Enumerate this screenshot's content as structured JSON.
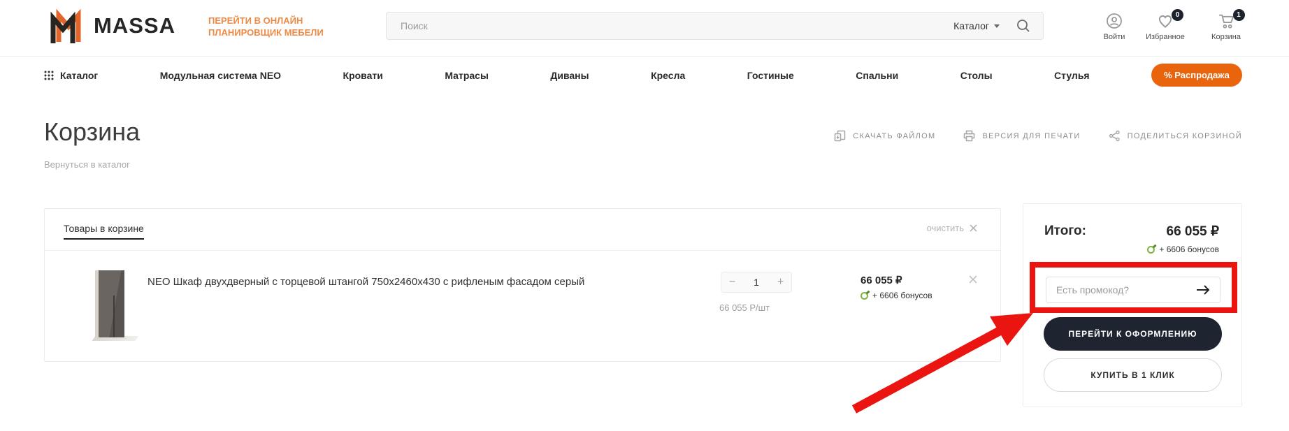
{
  "brand": {
    "name": "MASSA",
    "planner_link": "Перейти в онлайн планировщик мебели"
  },
  "header": {
    "search_placeholder": "Поиск",
    "catalog_dropdown": "Каталог",
    "account": {
      "label": "Войти"
    },
    "favorites": {
      "label": "Избранное",
      "count": "0"
    },
    "cart": {
      "label": "Корзина",
      "count": "1"
    }
  },
  "nav": {
    "items": [
      "Каталог",
      "Модульная система NEO",
      "Кровати",
      "Матрасы",
      "Диваны",
      "Кресла",
      "Гостиные",
      "Спальни",
      "Столы",
      "Стулья"
    ],
    "sale_label": "% Распродажа"
  },
  "page": {
    "title": "Корзина",
    "back_link": "Вернуться в каталог",
    "actions": [
      "Скачать файлом",
      "Версия для печати",
      "Поделиться корзиной"
    ]
  },
  "cart_panel": {
    "tab": "Товары в корзине",
    "clear_label": "очистить",
    "item": {
      "name": "NEO Шкаф двухдверный с торцевой штангой 750х2460х430 с рифленым фасадом серый",
      "quantity": "1",
      "qty_minus": "−",
      "qty_plus": "+",
      "price": "66 055 ₽",
      "bonus": "+ 6606 бонусов",
      "unit_price": "66 055 Р/шт"
    }
  },
  "summary": {
    "total_label": "Итого:",
    "total_value": "66 055 ₽",
    "bonus": "+ 6606 бонусов",
    "promo_placeholder": "Есть промокод?",
    "checkout_button": "Перейти к оформлению",
    "one_click_button": "Купить в 1 клик"
  },
  "colors": {
    "accent_orange": "#E8650E",
    "logo_orange": "#E2662A",
    "link_orange": "#EE8A45",
    "dark_button": "#1E2530",
    "bonus_green": "#7CB342",
    "annotation_red": "#EA1410"
  }
}
